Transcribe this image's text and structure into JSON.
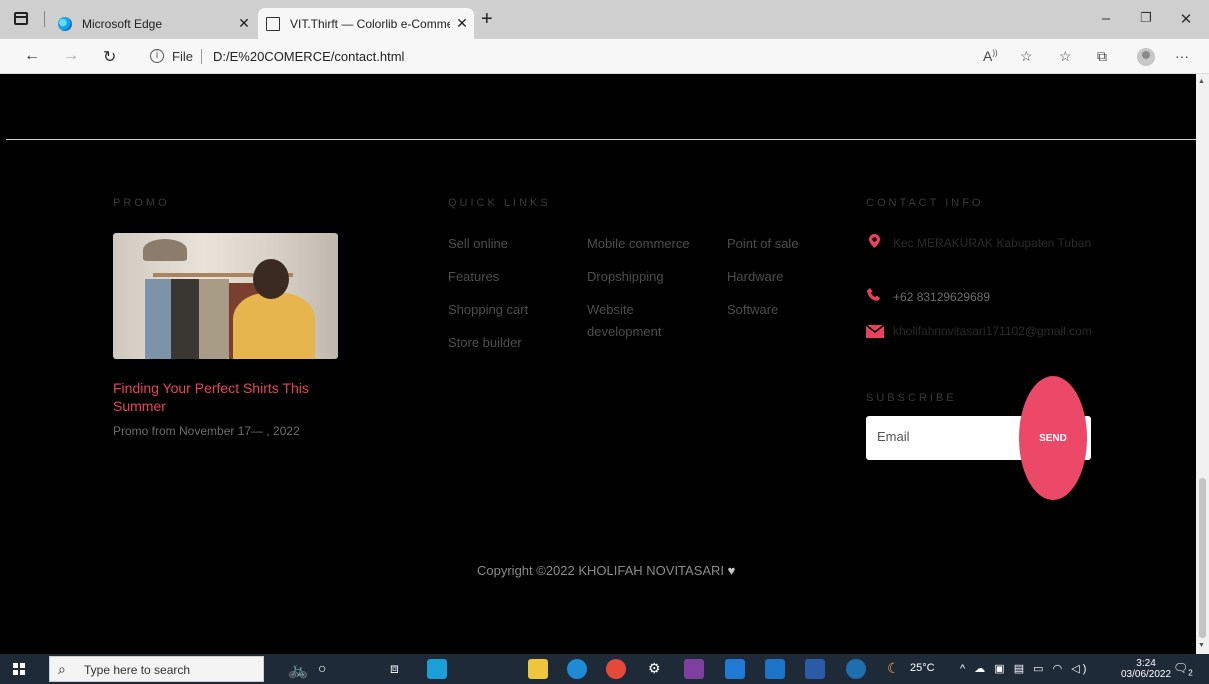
{
  "browser": {
    "tabs": [
      {
        "title": "Microsoft Edge",
        "active": false
      },
      {
        "title": "VIT.Thirft — Colorlib e-Commerce",
        "active": true
      }
    ],
    "address": {
      "scheme": "File",
      "url": "D:/E%20COMERCE/contact.html"
    }
  },
  "footer": {
    "promo": {
      "heading": "PROMO",
      "title": "Finding Your Perfect Shirts This Summer",
      "date": "Promo from November 17— , 2022"
    },
    "quick_links": {
      "heading": "QUICK LINKS",
      "col1": [
        "Sell online",
        "Features",
        "Shopping cart",
        "Store builder"
      ],
      "col2": [
        "Mobile commerce",
        "Dropshipping",
        "Website development"
      ],
      "col3": [
        "Point of sale",
        "Hardware",
        "Software"
      ]
    },
    "contact": {
      "heading": "CONTACT INFO",
      "address": "Kec MERAKURAK Kabupaten Tuban",
      "phone": "+62 83129629689",
      "email": "kholifahnovitasari171102@gmail.com"
    },
    "subscribe": {
      "heading": "SUBSCRIBE",
      "placeholder": "Email",
      "button": "SEND"
    },
    "copyright": "Copyright ©2022 KHOLIFAH NOVITASARI"
  },
  "taskbar": {
    "search_placeholder": "Type here to search",
    "temperature": "25°C",
    "time": "3:24",
    "date": "03/06/2022",
    "notification_count": "2"
  },
  "colors": {
    "accent": "#e8415e",
    "send_button": "#ec4868",
    "background": "#000000"
  }
}
